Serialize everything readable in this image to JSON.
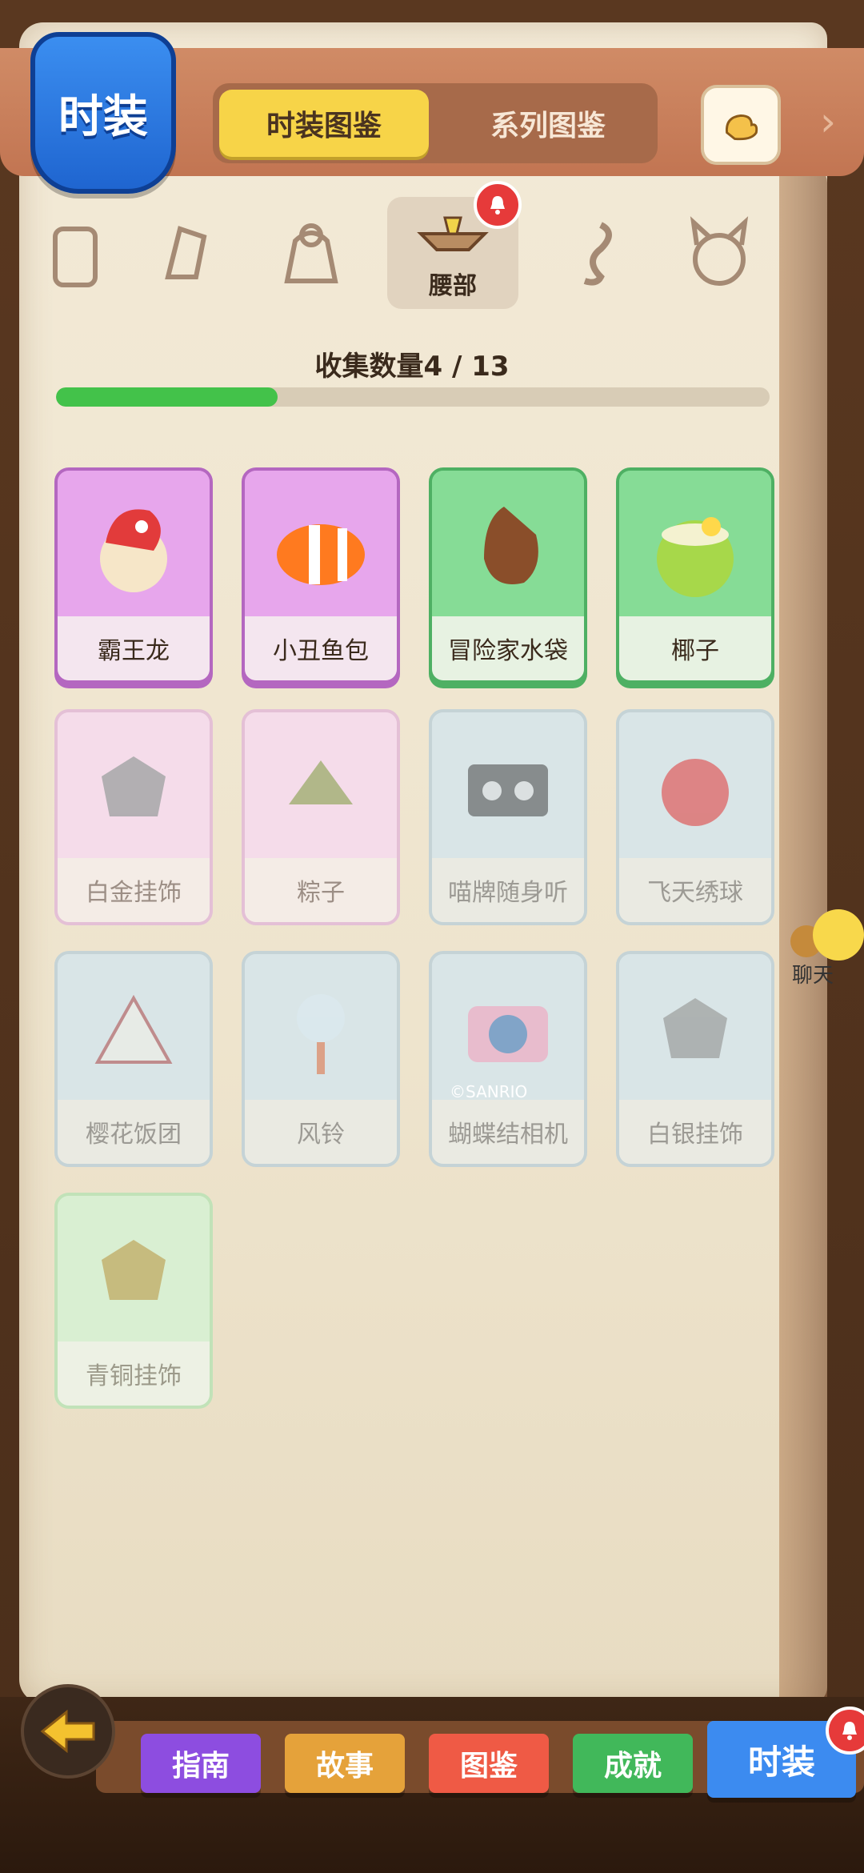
{
  "header": {
    "badge_label": "时装",
    "tab_active": "时装图鉴",
    "tab_inactive": "系列图鉴"
  },
  "categories": {
    "selected_label": "腰部",
    "items": [
      "bag-icon",
      "hand-icon",
      "torso-icon",
      "waist-icon",
      "tail-icon",
      "face-icon"
    ]
  },
  "collection": {
    "label": "收集数量4 / 13",
    "progress": 0.31
  },
  "items": [
    {
      "name": "霸王龙",
      "style": "purple",
      "icon": "dino-icon"
    },
    {
      "name": "小丑鱼包",
      "style": "purple",
      "icon": "clownfish-icon"
    },
    {
      "name": "冒险家水袋",
      "style": "green",
      "icon": "waterbag-icon"
    },
    {
      "name": "椰子",
      "style": "green",
      "icon": "coconut-icon"
    },
    {
      "name": "白金挂饰",
      "style": "dim-pink",
      "icon": "platinum-charm-icon"
    },
    {
      "name": "粽子",
      "style": "dim-pink",
      "icon": "zongzi-icon"
    },
    {
      "name": "喵牌随身听",
      "style": "dim-blue",
      "icon": "cassette-icon"
    },
    {
      "name": "飞天绣球",
      "style": "dim-blue",
      "icon": "embroidered-ball-icon"
    },
    {
      "name": "樱花饭团",
      "style": "dim-blue",
      "icon": "rice-ball-icon"
    },
    {
      "name": "风铃",
      "style": "dim-blue",
      "icon": "wind-chime-icon"
    },
    {
      "name": "蝴蝶结相机",
      "style": "dim-blue",
      "icon": "camera-icon"
    },
    {
      "name": "白银挂饰",
      "style": "dim-blue",
      "icon": "silver-charm-icon"
    },
    {
      "name": "青铜挂饰",
      "style": "dim-green",
      "icon": "bronze-charm-icon"
    }
  ],
  "camera_caption": "©SANRIO",
  "chat": {
    "label": "聊天"
  },
  "bottom_nav": {
    "guide": "指南",
    "story": "故事",
    "collection": "图鉴",
    "achievement": "成就",
    "fashion": "时装"
  }
}
